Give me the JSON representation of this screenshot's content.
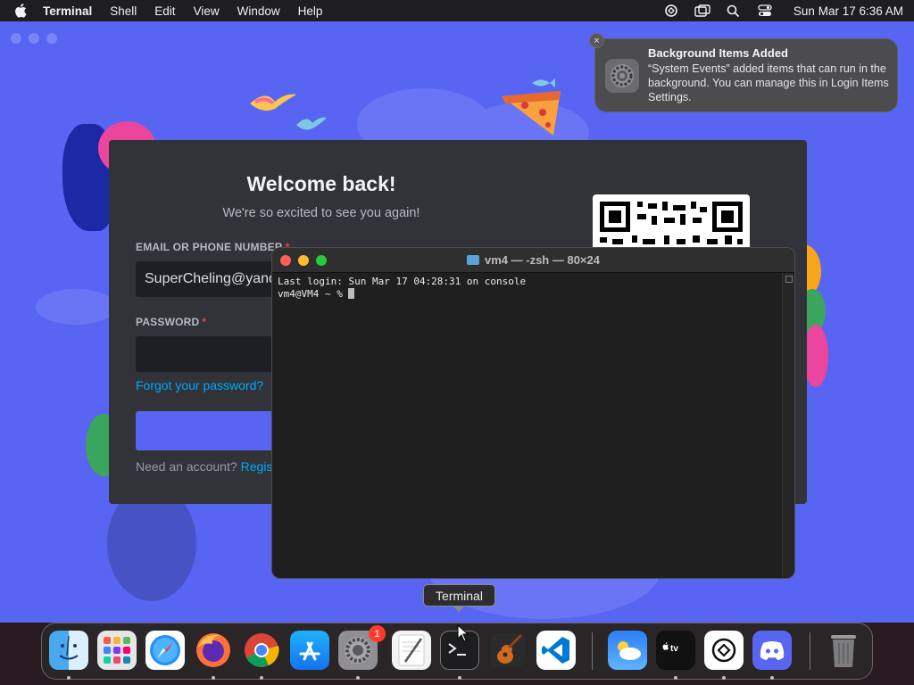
{
  "menubar": {
    "app_name": "Terminal",
    "items": [
      "Shell",
      "Edit",
      "View",
      "Window",
      "Help"
    ],
    "clock": "Sun Mar 17  6:36 AM"
  },
  "discord_login": {
    "title": "Welcome back!",
    "subtitle": "We're so excited to see you again!",
    "email_label": "EMAIL OR PHONE NUMBER",
    "email_value": "SuperCheling@yandex.ru",
    "password_label": "PASSWORD",
    "required_mark": "*",
    "forgot_link": "Forgot your password?",
    "need_account": "Need an account?",
    "register_link": "Register"
  },
  "notification": {
    "title": "Background Items Added",
    "body": "“System Events” added items that can run in the background. You can manage this in Login Items Settings.",
    "close_glyph": "×"
  },
  "terminal": {
    "title": "vm4 — -zsh — 80×24",
    "last_login": "Last login: Sun Mar 17 04:28:31 on console",
    "prompt": "vm4@VM4 ~ % "
  },
  "tooltip": {
    "text": "Terminal"
  },
  "dock": {
    "items": [
      "Finder",
      "Launchpad",
      "Safari",
      "Firefox",
      "Google Chrome",
      "App Store",
      "System Settings",
      "TextEdit",
      "Terminal",
      "GarageBand",
      "Visual Studio Code",
      "Weather",
      "Apple TV",
      "ChatGPT",
      "Discord",
      "Trash"
    ],
    "settings_badge": "1"
  },
  "colors": {
    "discord_blurple": "#5865f2",
    "discord_card": "#313338",
    "link": "#00a8fc",
    "required": "#f23f43"
  }
}
